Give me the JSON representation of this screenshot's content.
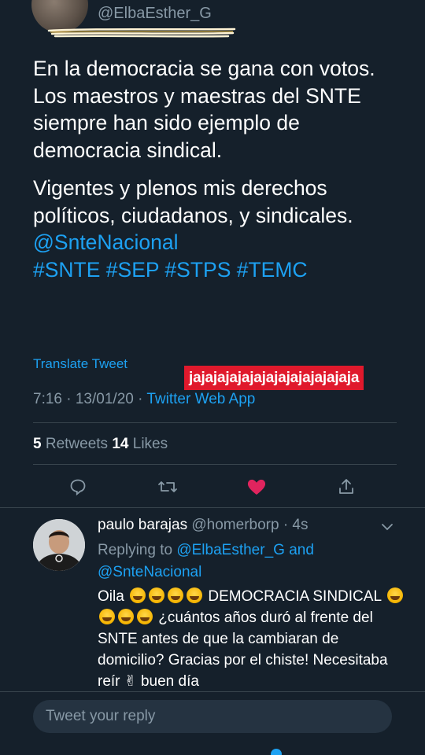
{
  "author": {
    "handle": "@ElbaEsther_G"
  },
  "tweet": {
    "paragraph1": "En la democracia se gana con votos. Los maestros y maestras del SNTE siempre han sido ejemplo de democracia sindical.",
    "paragraph2_text": "Vigentes y plenos mis derechos políticos, ciudadanos, y sindicales.",
    "mention": "@SnteNacional",
    "hashtags": "#SNTE #SEP #STPS #TEMC",
    "translate_label": "Translate Tweet",
    "sticker_text": "jajajajajajajajajajajajajaja",
    "time": "7:16 · 13/01/20 · ",
    "source_app": "Twitter Web App",
    "retweets_count": "5",
    "retweets_label": " Retweets ",
    "likes_count": "14",
    "likes_label": " Likes"
  },
  "actions": {
    "reply_icon": "reply-icon",
    "retweet_icon": "retweet-icon",
    "like_icon": "heart-icon",
    "share_icon": "share-icon",
    "like_color": "#e0245e"
  },
  "reply": {
    "name": "paulo barajas",
    "handle_time": " @homerborp · 4s",
    "replying_prefix": "Replying to ",
    "replying_user1": "@ElbaEsther_G",
    "replying_and": " and",
    "replying_user2": "@SnteNacional",
    "text_part1": "Oila",
    "text_part2": "DEMOCRACIA SINDICAL",
    "text_part3": "¿cuántos años duró al frente del SNTE antes de que la cambiaran de domicilio?  Gracias por el chiste! Necesitaba reír",
    "text_part4": "buen día"
  },
  "composer": {
    "placeholder": "Tweet your reply"
  },
  "colors": {
    "background": "#15202b",
    "link": "#1da1f2",
    "muted": "#8899a6",
    "sticker": "#e0192c"
  }
}
